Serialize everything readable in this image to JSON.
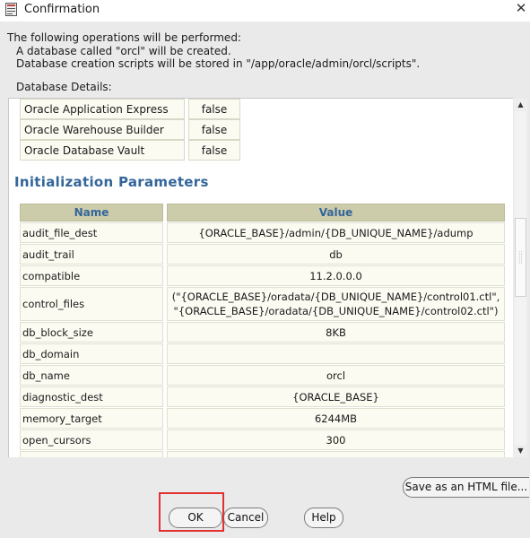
{
  "window": {
    "title": "Confirmation",
    "close_glyph": "✕",
    "icon": "oracle-app-icon"
  },
  "intro": {
    "line1": "The following operations will be performed:",
    "line2": "A database called \"orcl\" will be created.",
    "line3": "Database creation scripts will be stored in \"/app/oracle/admin/orcl/scripts\"."
  },
  "details_label": "Database Details:",
  "options_table": [
    {
      "name": "Oracle Application Express",
      "value": "false"
    },
    {
      "name": "Oracle Warehouse Builder",
      "value": "false"
    },
    {
      "name": "Oracle Database Vault",
      "value": "false"
    }
  ],
  "init_params": {
    "title": "Initialization Parameters",
    "headers": {
      "name": "Name",
      "value": "Value"
    },
    "rows": [
      {
        "name": "audit_file_dest",
        "value": "{ORACLE_BASE}/admin/{DB_UNIQUE_NAME}/adump"
      },
      {
        "name": "audit_trail",
        "value": "db"
      },
      {
        "name": "compatible",
        "value": "11.2.0.0.0"
      },
      {
        "name": "control_files",
        "value": "(\"{ORACLE_BASE}/oradata/{DB_UNIQUE_NAME}/control01.ctl\", \"{ORACLE_BASE}/oradata/{DB_UNIQUE_NAME}/control02.ctl\")"
      },
      {
        "name": "db_block_size",
        "value": "8KB"
      },
      {
        "name": "db_domain",
        "value": ""
      },
      {
        "name": "db_name",
        "value": "orcl"
      },
      {
        "name": "diagnostic_dest",
        "value": "{ORACLE_BASE}"
      },
      {
        "name": "memory_target",
        "value": "6244MB"
      },
      {
        "name": "open_cursors",
        "value": "300"
      },
      {
        "name": "",
        "value": ""
      }
    ]
  },
  "buttons": {
    "save_html": "Save as an HTML file...",
    "ok": "OK",
    "cancel": "Cancel",
    "help": "Help"
  },
  "colors": {
    "section_title": "#336699",
    "header_bg": "#ccccaa",
    "cell_bg": "#fbfbf2",
    "highlight": "#e03030"
  }
}
